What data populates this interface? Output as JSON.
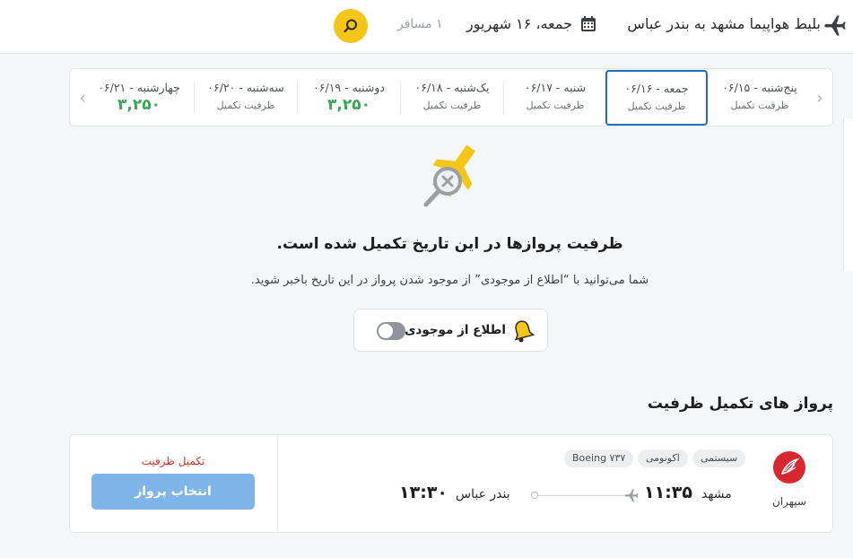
{
  "header": {
    "title": "بلیط هواپیما مشهد به بندر عباس",
    "date": "جمعه، ۱۶ شهریور",
    "passengers": "۱ مسافر",
    "icons": [
      "plane-icon",
      "calendar-icon",
      "search-icon"
    ]
  },
  "date_strip": {
    "days": [
      {
        "name": "پنج‌شنبه - ۰۶/۱۵",
        "status": "ظرفیت تکمیل",
        "price": ""
      },
      {
        "name": "جمعه - ۰۶/۱۶",
        "status": "ظرفیت تکمیل",
        "price": "",
        "selected": true
      },
      {
        "name": "شنبه - ۰۶/۱۷",
        "status": "ظرفیت تکمیل",
        "price": ""
      },
      {
        "name": "یک‌شنبه - ۰۶/۱۸",
        "status": "ظرفیت تکمیل",
        "price": ""
      },
      {
        "name": "دوشنبه - ۰۶/۱۹",
        "status": "",
        "price": "۳,۲۵۰"
      },
      {
        "name": "سه‌شنبه - ۰۶/۲۰",
        "status": "ظرفیت تکمیل",
        "price": ""
      },
      {
        "name": "چهارشنبه - ۰۶/۲۱",
        "status": "",
        "price": "۳,۲۵۰"
      }
    ],
    "price_color": "#34a853",
    "selected_color": "#1f6fb2"
  },
  "empty_state": {
    "title": "ظرفیت پروازها در این تاریخ تکمیل شده است.",
    "description": "شما می‌توانید با “اطلاع از موجودی” از موجود شدن پرواز در این تاریخ باخبر شوید.",
    "notify_label": "اطلاع از موجودی",
    "toggle_on": false
  },
  "section": {
    "title": "پرواز های تکمیل ظرفیت"
  },
  "flight": {
    "airline": "سپهران",
    "tags": [
      "سیستمی",
      "اکونومی",
      "Boeing ۷۳۷"
    ],
    "departure_city": "مشهد",
    "departure_time": "۱۱:۳۵",
    "arrival_city": "بندر عباس",
    "arrival_time": "۱۳:۳۰",
    "capacity_note": "تکمیل ظرفیت",
    "select_label": "انتخاب پرواز",
    "brand_color": "#d7282f",
    "button_color": "#7fb5e8"
  }
}
